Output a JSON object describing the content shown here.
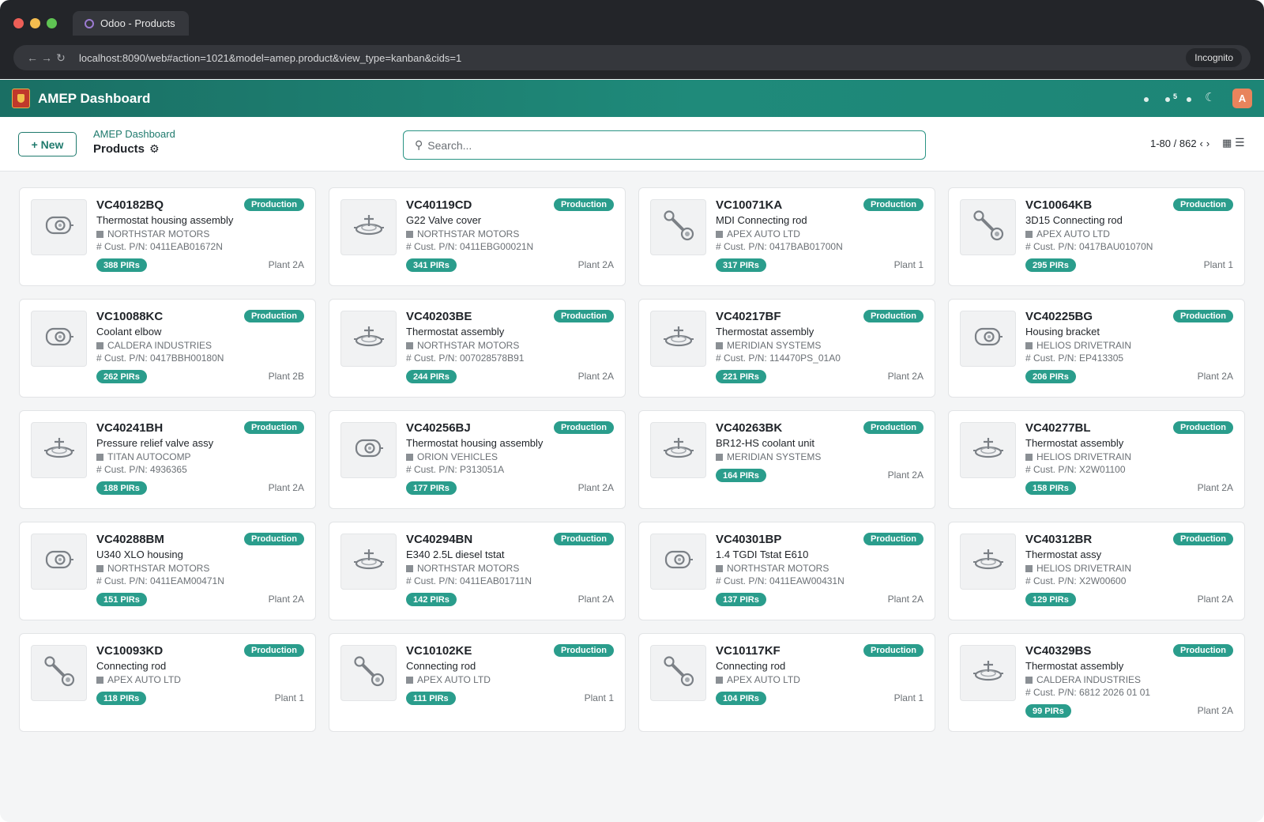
{
  "browser": {
    "tab_title": "Odoo - Products",
    "url": "localhost:8090/web#action=1021&model=amep.product&view_type=kanban&cids=1",
    "incognito_label": "Incognito",
    "nav": {
      "back": "←",
      "forward": "→",
      "reload": "↻"
    }
  },
  "header": {
    "app_title": "AMEP Dashboard",
    "notification_count": "5",
    "theme_icon": "moon-icon",
    "avatar_initial": "A",
    "brand_color": "#1f8a7a"
  },
  "control": {
    "new_label": "+ New",
    "breadcrumb": "AMEP Dashboard",
    "page_title": "Products",
    "search_placeholder": "Search...",
    "pager": "1-80 / 862",
    "prev": "‹",
    "next": "›"
  },
  "cards": [
    {
      "ref": "VC40182BQ",
      "status": "Production",
      "name": "Thermostat housing assembly",
      "customer": "NORTHSTAR MOTORS",
      "cust_pn": "# Cust. P/N: 0411EAB01672N",
      "pirs": "388 PIRs",
      "plant": "Plant 2A",
      "icon": "housing-icon"
    },
    {
      "ref": "VC40119CD",
      "status": "Production",
      "name": "G22 Valve cover",
      "customer": "NORTHSTAR MOTORS",
      "cust_pn": "# Cust. P/N: 0411EBG00021N",
      "pirs": "341 PIRs",
      "plant": "Plant 2A",
      "icon": "thermostat-icon"
    },
    {
      "ref": "VC10071KA",
      "status": "Production",
      "name": "MDI Connecting rod",
      "customer": "APEX AUTO LTD",
      "cust_pn": "# Cust. P/N: 0417BAB01700N",
      "pirs": "317 PIRs",
      "plant": "Plant 1",
      "icon": "connecting-rod-icon"
    },
    {
      "ref": "VC10064KB",
      "status": "Production",
      "name": "3D15 Connecting rod",
      "customer": "APEX AUTO LTD",
      "cust_pn": "# Cust. P/N: 0417BAU01070N",
      "pirs": "295 PIRs",
      "plant": "Plant 1",
      "icon": "connecting-rod-icon"
    },
    {
      "ref": "VC10088KC",
      "status": "Production",
      "name": "Coolant elbow",
      "customer": "CALDERA INDUSTRIES",
      "cust_pn": "# Cust. P/N: 0417BBH00180N",
      "pirs": "262 PIRs",
      "plant": "Plant 2B",
      "icon": "housing-icon"
    },
    {
      "ref": "VC40203BE",
      "status": "Production",
      "name": "Thermostat assembly",
      "customer": "NORTHSTAR MOTORS",
      "cust_pn": "# Cust. P/N: 007028578B91",
      "pirs": "244 PIRs",
      "plant": "Plant 2A",
      "icon": "thermostat-icon"
    },
    {
      "ref": "VC40217BF",
      "status": "Production",
      "name": "Thermostat assembly",
      "customer": "MERIDIAN SYSTEMS",
      "cust_pn": "# Cust. P/N: 114470PS_01A0",
      "pirs": "221 PIRs",
      "plant": "Plant 2A",
      "icon": "thermostat-icon"
    },
    {
      "ref": "VC40225BG",
      "status": "Production",
      "name": "Housing bracket",
      "customer": "HELIOS DRIVETRAIN",
      "cust_pn": "# Cust. P/N: EP413305",
      "pirs": "206 PIRs",
      "plant": "Plant 2A",
      "icon": "housing-icon"
    },
    {
      "ref": "VC40241BH",
      "status": "Production",
      "name": "Pressure relief valve assy",
      "customer": "TITAN AUTOCOMP",
      "cust_pn": "# Cust. P/N: 4936365",
      "pirs": "188 PIRs",
      "plant": "Plant 2A",
      "icon": "thermostat-icon"
    },
    {
      "ref": "VC40256BJ",
      "status": "Production",
      "name": "Thermostat housing assembly",
      "customer": "ORION VEHICLES",
      "cust_pn": "# Cust. P/N: P313051A",
      "pirs": "177 PIRs",
      "plant": "Plant 2A",
      "icon": "housing-icon"
    },
    {
      "ref": "VC40263BK",
      "status": "Production",
      "name": "BR12-HS coolant unit",
      "customer": "MERIDIAN SYSTEMS",
      "cust_pn": "",
      "pirs": "164 PIRs",
      "plant": "Plant 2A",
      "icon": "thermostat-icon"
    },
    {
      "ref": "VC40277BL",
      "status": "Production",
      "name": "Thermostat assembly",
      "customer": "HELIOS DRIVETRAIN",
      "cust_pn": "# Cust. P/N: X2W01100",
      "pirs": "158 PIRs",
      "plant": "Plant 2A",
      "icon": "thermostat-icon"
    },
    {
      "ref": "VC40288BM",
      "status": "Production",
      "name": "U340 XLO housing",
      "customer": "NORTHSTAR MOTORS",
      "cust_pn": "# Cust. P/N: 0411EAM00471N",
      "pirs": "151 PIRs",
      "plant": "Plant 2A",
      "icon": "housing-icon"
    },
    {
      "ref": "VC40294BN",
      "status": "Production",
      "name": "E340 2.5L diesel tstat",
      "customer": "NORTHSTAR MOTORS",
      "cust_pn": "# Cust. P/N: 0411EAB01711N",
      "pirs": "142 PIRs",
      "plant": "Plant 2A",
      "icon": "thermostat-icon"
    },
    {
      "ref": "VC40301BP",
      "status": "Production",
      "name": "1.4 TGDI Tstat E610",
      "customer": "NORTHSTAR MOTORS",
      "cust_pn": "# Cust. P/N: 0411EAW00431N",
      "pirs": "137 PIRs",
      "plant": "Plant 2A",
      "icon": "housing-icon"
    },
    {
      "ref": "VC40312BR",
      "status": "Production",
      "name": "Thermostat assy",
      "customer": "HELIOS DRIVETRAIN",
      "cust_pn": "# Cust. P/N: X2W00600",
      "pirs": "129 PIRs",
      "plant": "Plant 2A",
      "icon": "thermostat-icon"
    },
    {
      "ref": "VC10093KD",
      "status": "Production",
      "name": "Connecting rod",
      "customer": "APEX AUTO LTD",
      "cust_pn": "",
      "pirs": "118 PIRs",
      "plant": "Plant 1",
      "icon": "connecting-rod-icon"
    },
    {
      "ref": "VC10102KE",
      "status": "Production",
      "name": "Connecting rod",
      "customer": "APEX AUTO LTD",
      "cust_pn": "",
      "pirs": "111 PIRs",
      "plant": "Plant 1",
      "icon": "connecting-rod-icon"
    },
    {
      "ref": "VC10117KF",
      "status": "Production",
      "name": "Connecting rod",
      "customer": "APEX AUTO LTD",
      "cust_pn": "",
      "pirs": "104 PIRs",
      "plant": "Plant 1",
      "icon": "connecting-rod-icon"
    },
    {
      "ref": "VC40329BS",
      "status": "Production",
      "name": "Thermostat assembly",
      "customer": "CALDERA INDUSTRIES",
      "cust_pn": "# Cust. P/N: 6812 2026 01 01",
      "pirs": "99 PIRs",
      "plant": "Plant 2A",
      "icon": "thermostat-icon"
    }
  ]
}
